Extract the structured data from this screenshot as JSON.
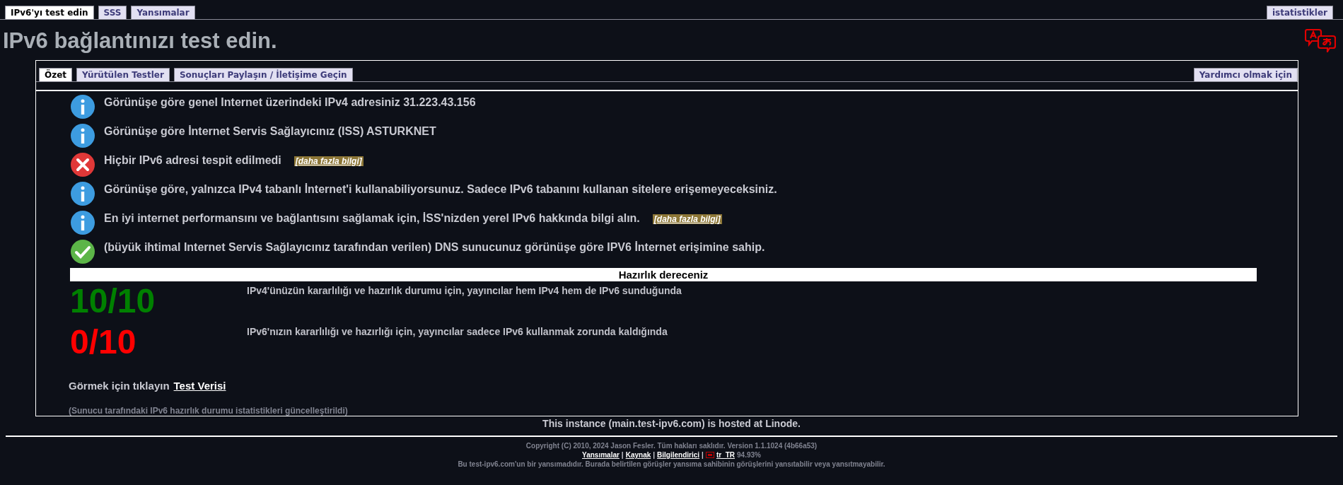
{
  "nav": {
    "tabs": [
      {
        "label": "IPv6'yı test edin",
        "selected": true
      },
      {
        "label": "SSS",
        "selected": false
      },
      {
        "label": "Yansımalar",
        "selected": false
      }
    ],
    "right_tab": {
      "label": "istatistikler",
      "selected": false
    }
  },
  "title": "IPv6 bağlantınızı test edin.",
  "panel": {
    "tabs": [
      {
        "label": "Özet",
        "selected": true
      },
      {
        "label": "Yürütülen Testler",
        "selected": false
      },
      {
        "label": "Sonuçları Paylaşın / İletişime Geçin",
        "selected": false
      }
    ],
    "right_tab": {
      "label": "Yardımcı olmak için",
      "selected": false
    },
    "results": [
      {
        "kind": "info",
        "text": "Görünüşe göre genel Internet üzerindeki IPv4 adresiniz 31.223.43.156"
      },
      {
        "kind": "info",
        "text": "Görünüşe göre İnternet Servis Sağlayıcınız (ISS) ASTURKNET"
      },
      {
        "kind": "error",
        "text": "Hiçbir IPv6 adresi tespit edilmedi",
        "link": "[daha fazla bilgi]"
      },
      {
        "kind": "info",
        "text": "Görünüşe göre, yalnızca IPv4 tabanlı İnternet'i kullanabiliyorsunuz. Sadece IPv6 tabanını kullanan sitelere erişemeyeceksiniz."
      },
      {
        "kind": "info",
        "text": "En iyi internet performansını ve bağlantısını sağlamak için, İSS'nizden yerel IPv6 hakkında bilgi alın.",
        "link": "[daha fazla bilgi]"
      },
      {
        "kind": "ok",
        "text": "(büyük ihtimal Internet Servis Sağlayıcınız tarafından verilen) DNS sunucunuz görünüşe göre IPV6 İnternet erişimine sahip."
      }
    ],
    "readiness": {
      "header": "Hazırlık dereceniz",
      "scores": [
        {
          "score": "10/10",
          "color": "#008000",
          "text": "IPv4'ünüzün kararlılığı ve hazırlık durumu için, yayıncılar hem IPv4 hem de IPv6 sunduğunda"
        },
        {
          "score": "0/10",
          "color": "#ff0000",
          "text": "IPv6'nızın kararlılığı ve hazırlığı için, yayıncılar sadece IPv6 kullanmak zorunda kaldığında"
        }
      ]
    },
    "see_prompt": "Görmek için tıklayın",
    "see_link": "Test Verisi",
    "note": "(Sunucu tarafındaki IPv6 hazırlık durumu istatistikleri güncelleştirildi)"
  },
  "hosted": "This instance (main.test-ipv6.com) is hosted at Linode.",
  "footer": {
    "copyright": "Copyright (C) 2010, 2024 Jason Fesler. Tüm hakları saklıdır. Version 1.1.1024 (4b66a53)",
    "links": [
      "Yansımalar",
      "Kaynak",
      "Bilgilendirici"
    ],
    "separators": [
      "|",
      "|",
      "|"
    ],
    "locale": "tr_TR",
    "locale_percent": "94.93%",
    "disclaimer": "Bu test-ipv6.com'un bir yansımadıdır. Burada belirtilen görüşler yansıma sahibinin görüşlerini yansıtabilir veya yansıtmayabilir."
  }
}
